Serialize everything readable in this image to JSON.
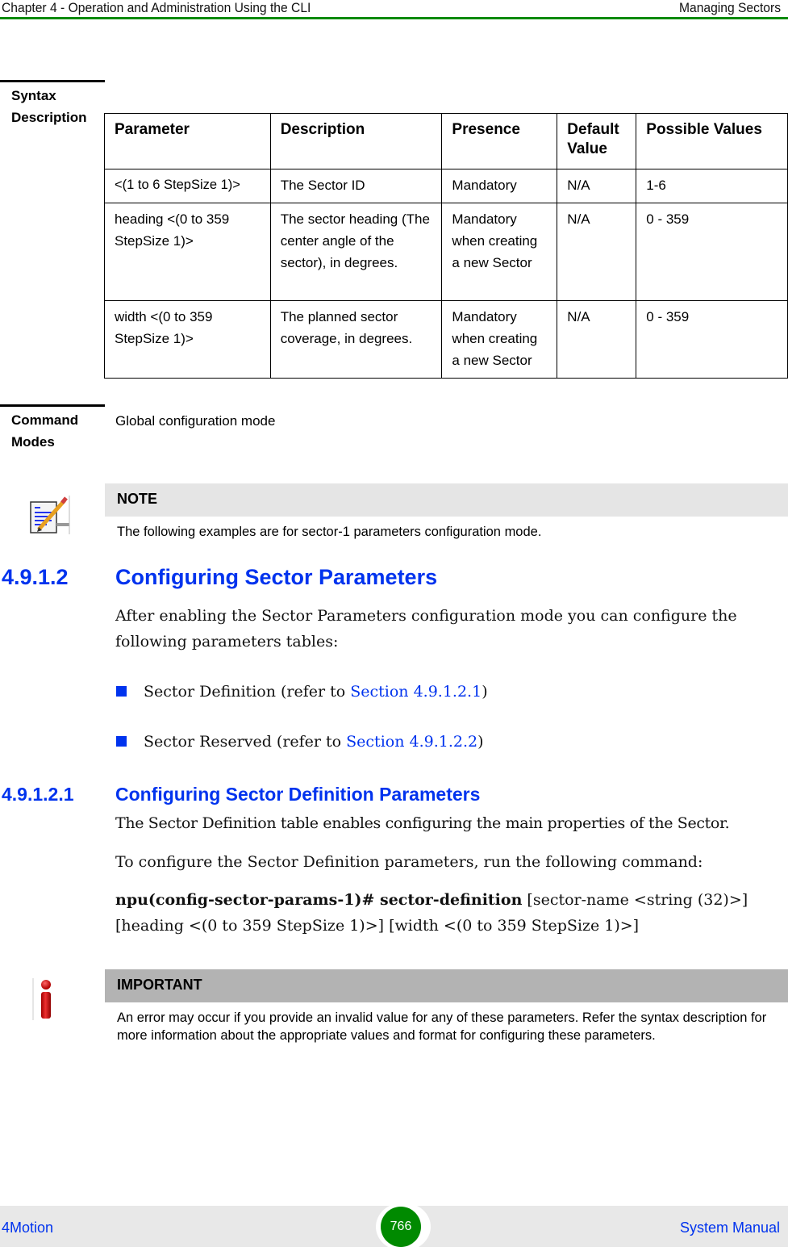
{
  "header": {
    "chapter": "Chapter 4 - Operation and Administration Using the CLI",
    "section": "Managing Sectors"
  },
  "syntax_description": {
    "label_line1": "Syntax",
    "label_line2": "Description",
    "table": {
      "columns": [
        "Parameter",
        "Description",
        "Presence",
        "Default Value",
        "Possible Values"
      ],
      "rows": [
        [
          "<(1 to 6 StepSize 1)>",
          "The Sector ID",
          "Mandatory",
          "N/A",
          "1-6"
        ],
        [
          "heading <(0 to 359 StepSize 1)>",
          "The sector heading (The center angle of the sector), in degrees.",
          "Mandatory when creating a new Sector",
          "N/A",
          "0 - 359"
        ],
        [
          "width <(0 to 359 StepSize 1)>",
          "The planned sector coverage, in degrees.",
          "Mandatory when creating a new Sector",
          "N/A",
          "0 - 359"
        ]
      ]
    }
  },
  "command_modes": {
    "label_line1": "Command",
    "label_line2": "Modes",
    "value": "Global configuration mode"
  },
  "note": {
    "icon": "note-pencil-icon",
    "title": "NOTE",
    "text": "The following examples are for sector-1 parameters configuration mode."
  },
  "section_4_9_1_2": {
    "number": "4.9.1.2",
    "title": "Configuring Sector Parameters",
    "intro": "After enabling the Sector Parameters configuration mode you can configure the following parameters tables:",
    "bullets": [
      {
        "text": "Sector Definition (refer to ",
        "link": "Section 4.9.1.2.1",
        "after": ")"
      },
      {
        "text": "Sector Reserved (refer to ",
        "link": "Section 4.9.1.2.2",
        "after": ")"
      }
    ],
    "bullet_color": "#0033ee"
  },
  "section_4_9_1_2_1": {
    "number": "4.9.1.2.1",
    "title": "Configuring Sector Definition Parameters",
    "para1": "The Sector Definition table enables configuring the main properties of the Sector.",
    "para2": "To configure the Sector Definition parameters, run the following command:",
    "command_bold": "npu(config-sector-params-1)# sector-definition",
    "command_args_line1": " [sector-name <string (32)>]",
    "command_args_line2": "[heading <(0 to 359 StepSize 1)>] [width <(0 to 359 StepSize 1)>]"
  },
  "important": {
    "icon": "info-important-icon",
    "title": "IMPORTANT",
    "text": "An error may occur if you provide an invalid value for any of these parameters. Refer the syntax description for more information about the appropriate values and format for configuring these parameters."
  },
  "footer": {
    "left": "4Motion",
    "page_number": "766",
    "right": "System Manual"
  },
  "colors": {
    "accent_green": "#008a00",
    "heading_blue": "#0033ee",
    "note_bg": "#e5e5e5",
    "important_bg": "#b3b3b3"
  }
}
